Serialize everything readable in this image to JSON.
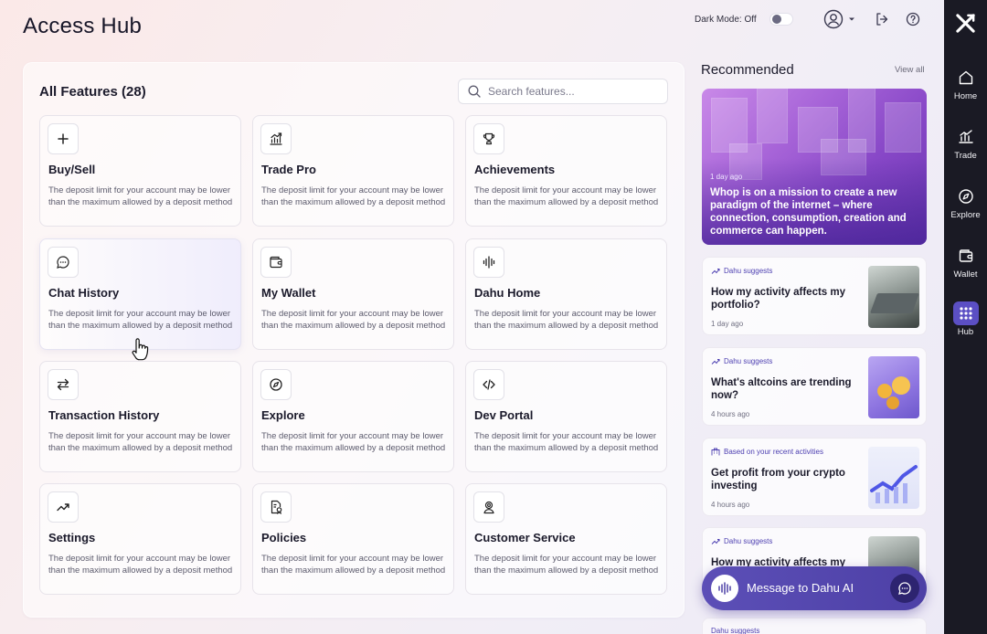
{
  "app": {
    "title": "Access Hub"
  },
  "topbar": {
    "dark_mode_label": "Dark Mode: Off",
    "dark_mode_on": false
  },
  "features": {
    "title": "All Features (28)",
    "search_placeholder": "Search features...",
    "cards": [
      {
        "title": "Buy/Sell",
        "icon": "plus-icon",
        "desc": "The deposit limit for your account may be lower than the maximum allowed by a deposit method"
      },
      {
        "title": "Trade Pro",
        "icon": "chart-icon",
        "desc": "The deposit limit for your account may be lower than the maximum allowed by a deposit method"
      },
      {
        "title": "Achievements",
        "icon": "trophy-icon",
        "desc": "The deposit limit for your account may be lower than the maximum allowed by a deposit method"
      },
      {
        "title": "Chat History",
        "icon": "chat-icon",
        "desc": "The deposit limit for your account may be lower than the maximum allowed by a deposit method"
      },
      {
        "title": "My Wallet",
        "icon": "wallet-icon",
        "desc": "The deposit limit for your account may be lower than the maximum allowed by a deposit method"
      },
      {
        "title": "Dahu Home",
        "icon": "soundwave-icon",
        "desc": "The deposit limit for your account may be lower than the maximum allowed by a deposit method"
      },
      {
        "title": "Transaction History",
        "icon": "swap-arrows-icon",
        "desc": "The deposit limit for your account may be lower than the maximum allowed by a deposit method"
      },
      {
        "title": "Explore",
        "icon": "compass-icon",
        "desc": "The deposit limit for your account may be lower than the maximum allowed by a deposit method"
      },
      {
        "title": "Dev Portal",
        "icon": "code-icon",
        "desc": "The deposit limit for your account may be lower than the maximum allowed by a deposit method"
      },
      {
        "title": "Settings",
        "icon": "trend-up-icon",
        "desc": "The deposit limit for your account may be lower than the maximum allowed by a deposit method"
      },
      {
        "title": "Policies",
        "icon": "document-icon",
        "desc": "The deposit limit for your account may be lower than the maximum allowed by a deposit method"
      },
      {
        "title": "Customer Service",
        "icon": "support-icon",
        "desc": "The deposit limit for your account may be lower than the maximum allowed by a deposit method"
      }
    ]
  },
  "recommended": {
    "title": "Recommended",
    "view_all": "View all",
    "hero": {
      "time": "1 day ago",
      "text": "Whop is on a mission to create a new paradigm of the internet – where connection, consumption, creation and commerce can happen."
    },
    "items": [
      {
        "source": "Dahu suggests",
        "title": "How my activity affects my portfolio?",
        "time": "1 day ago"
      },
      {
        "source": "Dahu suggests",
        "title": "What's altcoins are trending now?",
        "time": "4 hours ago"
      },
      {
        "source": "Based on your recent activities",
        "title": "Get profit from your crypto investing",
        "time": "4 hours ago"
      },
      {
        "source": "Dahu suggests",
        "title": "How my activity affects my",
        "time": ""
      }
    ],
    "peek_source": "Dahu suggests"
  },
  "ai_bar": {
    "label": "Message to Dahu AI"
  },
  "sidebar": {
    "items": [
      {
        "label": "Home",
        "icon": "home-icon"
      },
      {
        "label": "Trade",
        "icon": "trade-chart-icon"
      },
      {
        "label": "Explore",
        "icon": "compass-icon"
      },
      {
        "label": "Wallet",
        "icon": "wallet-icon"
      },
      {
        "label": "Hub",
        "icon": "grid-icon",
        "active": true
      }
    ]
  },
  "colors": {
    "accent": "#5b4fc4",
    "sidebar_bg": "#1a1a24",
    "ai_bar": "#5247ae"
  }
}
